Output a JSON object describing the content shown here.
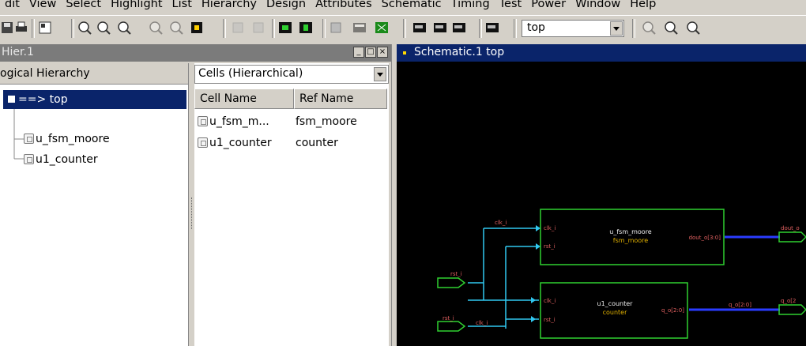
{
  "menu": [
    "dit",
    "View",
    "Select",
    "Highlight",
    "List",
    "Hierarchy",
    "Design",
    "Attributes",
    "Schematic",
    "Timing",
    "Test",
    "Power",
    "Window",
    "Help"
  ],
  "toolbar": {
    "design_combo_value": "top",
    "icons": [
      "save-icon",
      "print-icon",
      "properties-icon",
      "zoom-fit-icon",
      "zoom-in-icon",
      "zoom-out-icon",
      "zoom-area-icon",
      "zoom-select-icon",
      "stop-icon",
      "push-up-icon",
      "pop-down-icon",
      "schematic-icon",
      "symbol-icon",
      "layout-icon",
      "table-icon",
      "grid-icon",
      "view1-icon",
      "view2-icon",
      "view3-icon",
      "view4-icon",
      "zoom-full-icon",
      "zoom-plus-icon",
      "zoom-fit2-icon"
    ]
  },
  "hier_window": {
    "title": "Hier.1",
    "tree_header": "ogical Hierarchy",
    "tree": [
      {
        "label": "==> top",
        "selected": true
      },
      {
        "label": "u_fsm_moore",
        "selected": false
      },
      {
        "label": "u1_counter",
        "selected": false
      }
    ],
    "cells_combo": "Cells (Hierarchical)",
    "columns": [
      "Cell Name",
      "Ref Name"
    ],
    "rows": [
      {
        "cell": "u_fsm_m...",
        "ref": "fsm_moore"
      },
      {
        "cell": "u1_counter",
        "ref": "counter"
      }
    ]
  },
  "schematic_window": {
    "title": "Schematic.1  top",
    "instances": [
      {
        "name": "u_fsm_moore",
        "ref": "fsm_moore",
        "pins_in": [
          "clk_i",
          "rst_i"
        ],
        "pin_out": "dout_o[3:0]"
      },
      {
        "name": "u1_counter",
        "ref": "counter",
        "pins_in": [
          "clk_i",
          "rst_i"
        ],
        "pin_out": "q_o[2:0]"
      }
    ],
    "net_labels": [
      "clk_i",
      "rst_i",
      "clk_i",
      "rst_i",
      "q_o[2:0]",
      "dout_o",
      "q_o[2"
    ],
    "colors": {
      "box": "#2fd030",
      "pin": "#e06060",
      "ref": "#e0b000",
      "name": "#f0f0f0",
      "wire": "#30c8f0",
      "bus": "#2a3cff"
    }
  }
}
